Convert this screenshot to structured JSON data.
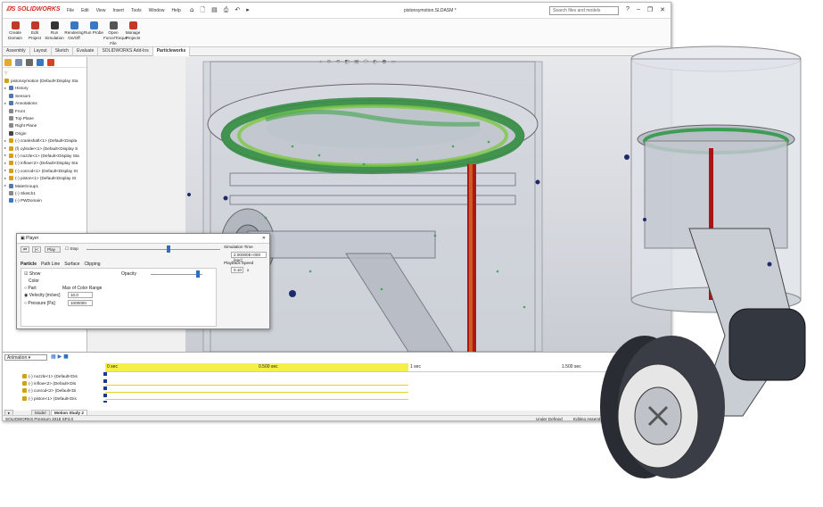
{
  "app": {
    "logo_brand": "SOLIDWORKS",
    "doc_title": "pistonsymotion.SLDASM *"
  },
  "menus": [
    "File",
    "Edit",
    "View",
    "Insert",
    "Tools",
    "Window",
    "Help"
  ],
  "search": {
    "placeholder": "Search files and models"
  },
  "window_controls": [
    "?",
    "–",
    "❐",
    "✕"
  ],
  "ribbon": [
    {
      "label": "Create Domain",
      "color": "#c0392b"
    },
    {
      "label": "Edit Project",
      "color": "#c0392b"
    },
    {
      "label": "Run Simulation",
      "color": "#333333"
    },
    {
      "label": "Rendering On/Off",
      "color": "#3a78c4"
    },
    {
      "label": "Run Probe",
      "color": "#3a78c4"
    },
    {
      "label": "Open Force/Torque File",
      "color": "#555555"
    },
    {
      "label": "Manage Projects",
      "color": "#c0392b"
    }
  ],
  "cmd_tabs": [
    "Assembly",
    "Layout",
    "Sketch",
    "Evaluate",
    "SOLIDWORKS Add-Ins",
    "Particleworks"
  ],
  "active_cmd_tab": "Particleworks",
  "tree_root": "pistonsymotion (Default<Display Sta",
  "tree": [
    {
      "label": "History",
      "expand": "▸",
      "color": "#5577aa"
    },
    {
      "label": "Sensors",
      "expand": "",
      "color": "#5577aa"
    },
    {
      "label": "Annotations",
      "expand": "▸",
      "color": "#5577aa"
    },
    {
      "label": "Front",
      "expand": "",
      "color": "#888888"
    },
    {
      "label": "Top Plane",
      "expand": "",
      "color": "#888888"
    },
    {
      "label": "Right Plane",
      "expand": "",
      "color": "#888888"
    },
    {
      "label": "Origin",
      "expand": "",
      "color": "#444444"
    },
    {
      "label": "(-) crankshaft<1> (Default<Displa",
      "expand": "▸",
      "color": "#d4a017"
    },
    {
      "label": "(f) cylinder<1> (Default<Display S",
      "expand": "▸",
      "color": "#d4a017"
    },
    {
      "label": "(-) nozzle<1> (Default<Display Sta",
      "expand": "▸",
      "color": "#d4a017"
    },
    {
      "label": "(-) inflow<2> (Default<Display Sta",
      "expand": "▸",
      "color": "#d4a017"
    },
    {
      "label": "(-) conrod<1> (Default<Display St",
      "expand": "▸",
      "color": "#d4a017"
    },
    {
      "label": "(-) piston<1> (Default<Display St",
      "expand": "▸",
      "color": "#d4a017"
    },
    {
      "label": "MateGroup1",
      "expand": "▸",
      "color": "#5577aa"
    },
    {
      "label": "(-) Sketch1",
      "expand": "",
      "color": "#888888"
    },
    {
      "label": "(-) PWDomain",
      "expand": "",
      "color": "#3a78c4"
    }
  ],
  "player": {
    "title": "Player",
    "play_label": "Play",
    "stop_label": "Stop",
    "tabs": [
      "Particle",
      "Path Line",
      "Surface",
      "Clipping"
    ],
    "show_label": "Show",
    "color_label": "Color",
    "opacity_label": "Opacity",
    "options": [
      "Part",
      "Velocity [m/sec]",
      "Pressure [Pa]"
    ],
    "max_label": "Max of Color Range",
    "velocity_max": "10.0",
    "pressure_max": "1000000",
    "sim_time_label": "Simulation Time",
    "sim_time_value": "2.00000E+000 [sec]",
    "playback_label": "Playback Speed",
    "playback_value": "0.10",
    "playback_unit": "x",
    "slider": 0.6
  },
  "motion": {
    "type_value": "Animation",
    "ticks": [
      "0 sec",
      "0.500 sec",
      "1 sec",
      "1.500 sec"
    ],
    "rows": [
      "(-) nozzle<1> (Default<Dis",
      "(-) inflow<2> (Default<Dis",
      "(-) conrod<2> (Default<Di",
      "(-) piston<1> (Default<Dis"
    ]
  },
  "bottom_tabs": [
    "Model",
    "Motion Study 2"
  ],
  "status": {
    "left": "SOLIDWORKS Premium 2018 SP4.0",
    "mid": "Under Defined",
    "right": "Editing Assembly"
  },
  "hud_icons": [
    "⌕",
    "⊕",
    "⟲",
    "◧",
    "▣",
    "⬡",
    "◐",
    "●",
    "▭"
  ],
  "qat_icons": [
    "⌂",
    "🗋",
    "▤",
    "⎙",
    "↶",
    "▸"
  ]
}
